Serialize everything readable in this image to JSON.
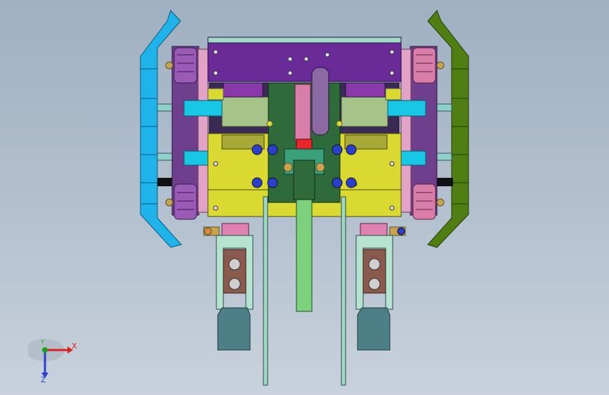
{
  "viewport": {
    "background_top": "#9fb0c2",
    "background_bottom": "#c9d2dc"
  },
  "model": {
    "colors": {
      "left_rail": "#1eb3ea",
      "right_rail": "#4f7f12",
      "top_plate": "#6a2b99",
      "yellow_block": "#d9d932",
      "center_blade": "#7cd17c",
      "leg_pad": "#4d7f86",
      "leg_block": "#8a5a4c",
      "cyan_shaft": "#18c7e6",
      "red_gear": "#e8262c",
      "pink_part": "#e082b1",
      "roller": "#9a5ab5",
      "green_frame": "#2ea05a"
    }
  },
  "axis_triad": {
    "x_label": "X",
    "y_label": "Y",
    "z_label": "Z",
    "x_color": "#e02020",
    "y_color": "#1aa31a",
    "z_color": "#2a3fd0"
  }
}
